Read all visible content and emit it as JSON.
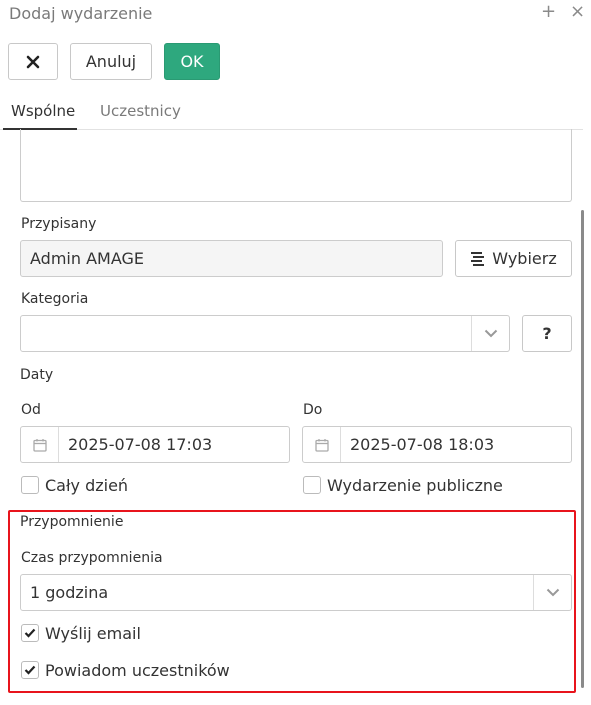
{
  "header": {
    "title": "Dodaj wydarzenie",
    "add_icon": "plus-icon",
    "close_icon": "close-icon"
  },
  "toolbar": {
    "close_icon": "x-icon",
    "cancel_label": "Anuluj",
    "ok_label": "OK"
  },
  "tabs": [
    {
      "label": "Wspólne",
      "active": true
    },
    {
      "label": "Uczestnicy",
      "active": false
    }
  ],
  "form": {
    "assigned": {
      "label": "Przypisany",
      "value": "Admin AMAGE",
      "button_label": "Wybierz",
      "button_icon": "list-icon"
    },
    "category": {
      "label": "Kategoria",
      "value": "",
      "help_label": "?"
    },
    "dates": {
      "label": "Daty",
      "from_label": "Od",
      "from_value": "2025-07-08 17:03",
      "to_label": "Do",
      "to_value": "2025-07-08 18:03",
      "all_day_label": "Cały dzień",
      "all_day_checked": false,
      "public_label": "Wydarzenie publiczne",
      "public_checked": false
    },
    "reminder": {
      "section_label": "Przypomnienie",
      "time_label": "Czas przypomnienia",
      "time_value": "1 godzina",
      "send_email_label": "Wyślij email",
      "send_email_checked": true,
      "notify_label": "Powiadom uczestników",
      "notify_checked": true
    }
  },
  "colors": {
    "ok_green": "#2ea87e",
    "highlight_red": "#e8141c"
  }
}
